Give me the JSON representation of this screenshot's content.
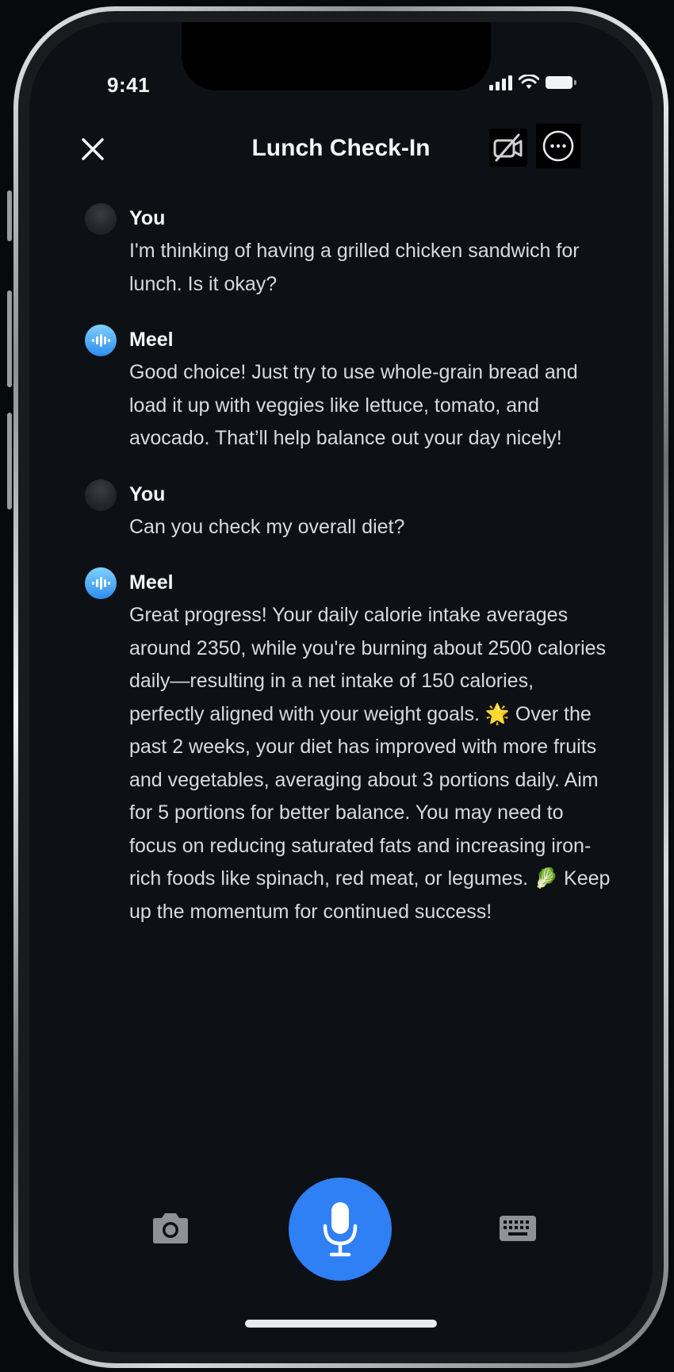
{
  "status_bar": {
    "time": "9:41"
  },
  "header": {
    "title": "Lunch Check-In",
    "close_icon": "close-icon",
    "camera_off_icon": "camera-off-icon",
    "more_icon": "more-options-icon"
  },
  "messages": [
    {
      "sender": "You",
      "role": "user",
      "text": "I'm thinking of having a grilled chicken sandwich for lunch. Is it okay?"
    },
    {
      "sender": "Meel",
      "role": "assistant",
      "text": "Good choice! Just try to use whole-grain bread and load it up with veggies like lettuce, tomato, and avocado. That’ll help balance out your day nicely!"
    },
    {
      "sender": "You",
      "role": "user",
      "text": "Can you check my overall diet?"
    },
    {
      "sender": "Meel",
      "role": "assistant",
      "text": "Great progress! Your daily calorie intake averages around 2350, while you're burning about 2500 calories daily—resulting in a net intake of 150 calories, perfectly aligned with your weight goals. 🌟 Over the past 2 weeks, your diet has improved with more fruits and vegetables, averaging about 3 portions daily. Aim for 5 portions for better balance. You may need to focus on reducing saturated fats and increasing iron-rich foods like spinach, red meat, or legumes. 🥬 Keep up the momentum for continued success!"
    }
  ],
  "bottom_bar": {
    "camera_icon": "camera-icon",
    "mic_icon": "microphone-icon",
    "keyboard_icon": "keyboard-icon"
  },
  "colors": {
    "background": "#0d1014",
    "accent": "#2f7ff5",
    "text_primary": "#f4f5f7",
    "text_secondary": "#d8dade"
  }
}
